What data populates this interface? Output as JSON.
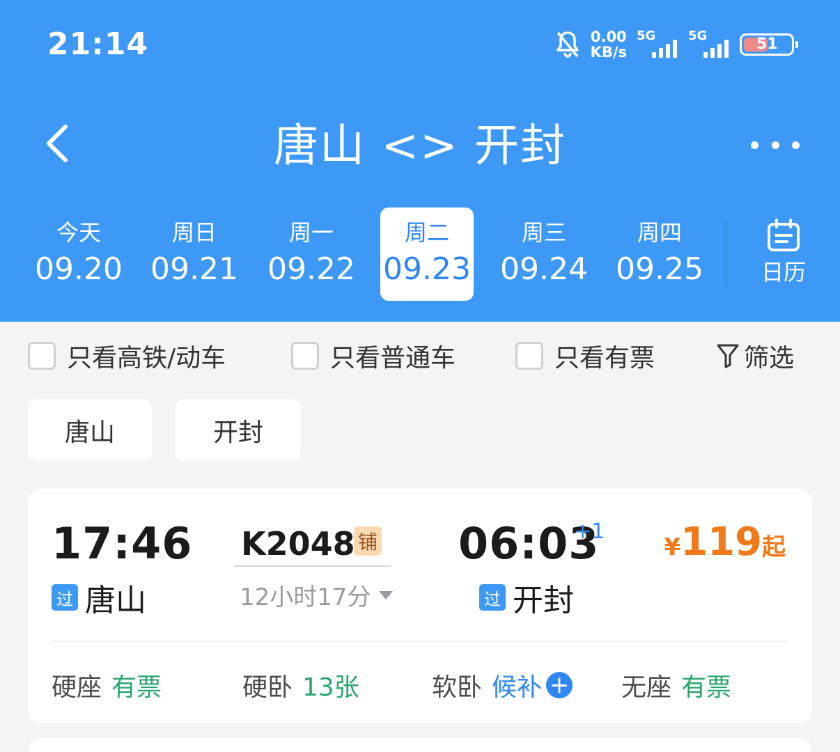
{
  "status_bar": {
    "time": "21:14",
    "net_speed": "0.00",
    "net_unit": "KB/s",
    "sim1": "5G",
    "sim2": "5G",
    "battery": "51",
    "battery_level": 0.51
  },
  "header": {
    "title": "唐山 <> 开封",
    "back_icon": "chevron-left-icon",
    "more_icon": "more-dots-icon"
  },
  "dates": [
    {
      "weekday": "今天",
      "date": "09.20"
    },
    {
      "weekday": "周日",
      "date": "09.21"
    },
    {
      "weekday": "周一",
      "date": "09.22"
    },
    {
      "weekday": "周二",
      "date": "09.23",
      "selected": true
    },
    {
      "weekday": "周三",
      "date": "09.24"
    },
    {
      "weekday": "周四",
      "date": "09.25"
    }
  ],
  "calendar_label": "日历",
  "filters": {
    "high_speed": "只看高铁/动车",
    "normal": "只看普通车",
    "available": "只看有票",
    "filter": "筛选"
  },
  "stations": [
    "唐山",
    "开封"
  ],
  "train": {
    "depart_time": "17:46",
    "depart_tag": "过",
    "depart_station": "唐山",
    "number": "K2048",
    "badge": "铺",
    "duration": "12小时17分",
    "arrive_time": "06:03",
    "next_day": "+1",
    "arrive_tag": "过",
    "arrive_station": "开封",
    "price_symbol": "¥",
    "price": "119",
    "price_suffix": "起",
    "seats": [
      {
        "name": "硬座",
        "status": "有票"
      },
      {
        "name": "硬卧",
        "status": "13张"
      },
      {
        "name": "软卧",
        "status": "候补"
      },
      {
        "name": "无座",
        "status": "有票"
      }
    ]
  },
  "colors": {
    "brand_blue": "#3d99f5",
    "price_orange": "#f07a1a",
    "available_green": "#2aa66e"
  }
}
